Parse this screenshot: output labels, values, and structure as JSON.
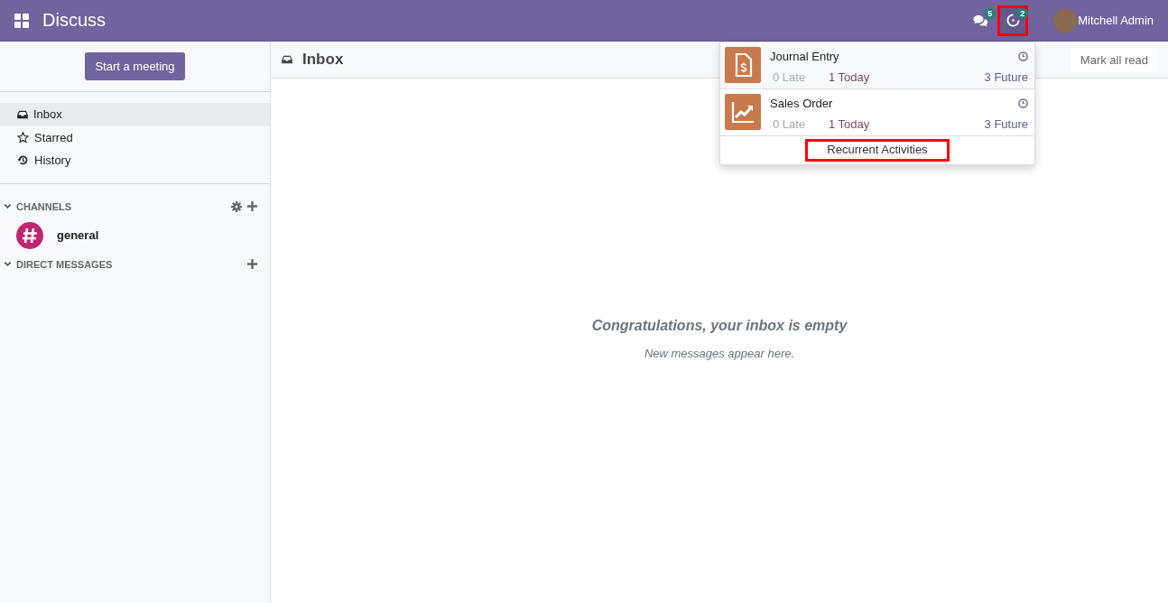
{
  "navbar": {
    "app_title": "Discuss",
    "messages_badge": "5",
    "activities_badge": "2",
    "activities_highlighted": true,
    "user_name": "Mitchell Admin"
  },
  "sidebar": {
    "start_button": "Start a meeting",
    "mailboxes": [
      {
        "label": "Inbox",
        "kind": "inbox",
        "selected": true
      },
      {
        "label": "Starred",
        "kind": "star",
        "selected": false
      },
      {
        "label": "History",
        "kind": "history",
        "selected": false
      }
    ],
    "channels_header": "CHANNELS",
    "channels": [
      {
        "name": "general"
      }
    ],
    "direct_messages_header": "DIRECT MESSAGES"
  },
  "main": {
    "title": "Inbox",
    "mark_all_read": "Mark all read",
    "empty_title": "Congratulations, your inbox is empty",
    "empty_subtitle": "New messages appear here."
  },
  "activities_dropdown": {
    "items": [
      {
        "kind": "invoice",
        "name": "Journal Entry",
        "late": "0 Late",
        "today": "1 Today",
        "future": "3 Future"
      },
      {
        "kind": "chart",
        "name": "Sales Order",
        "late": "0 Late",
        "today": "1 Today",
        "future": "3 Future"
      }
    ],
    "footer": "Recurrent Activities",
    "footer_highlighted": true
  }
}
